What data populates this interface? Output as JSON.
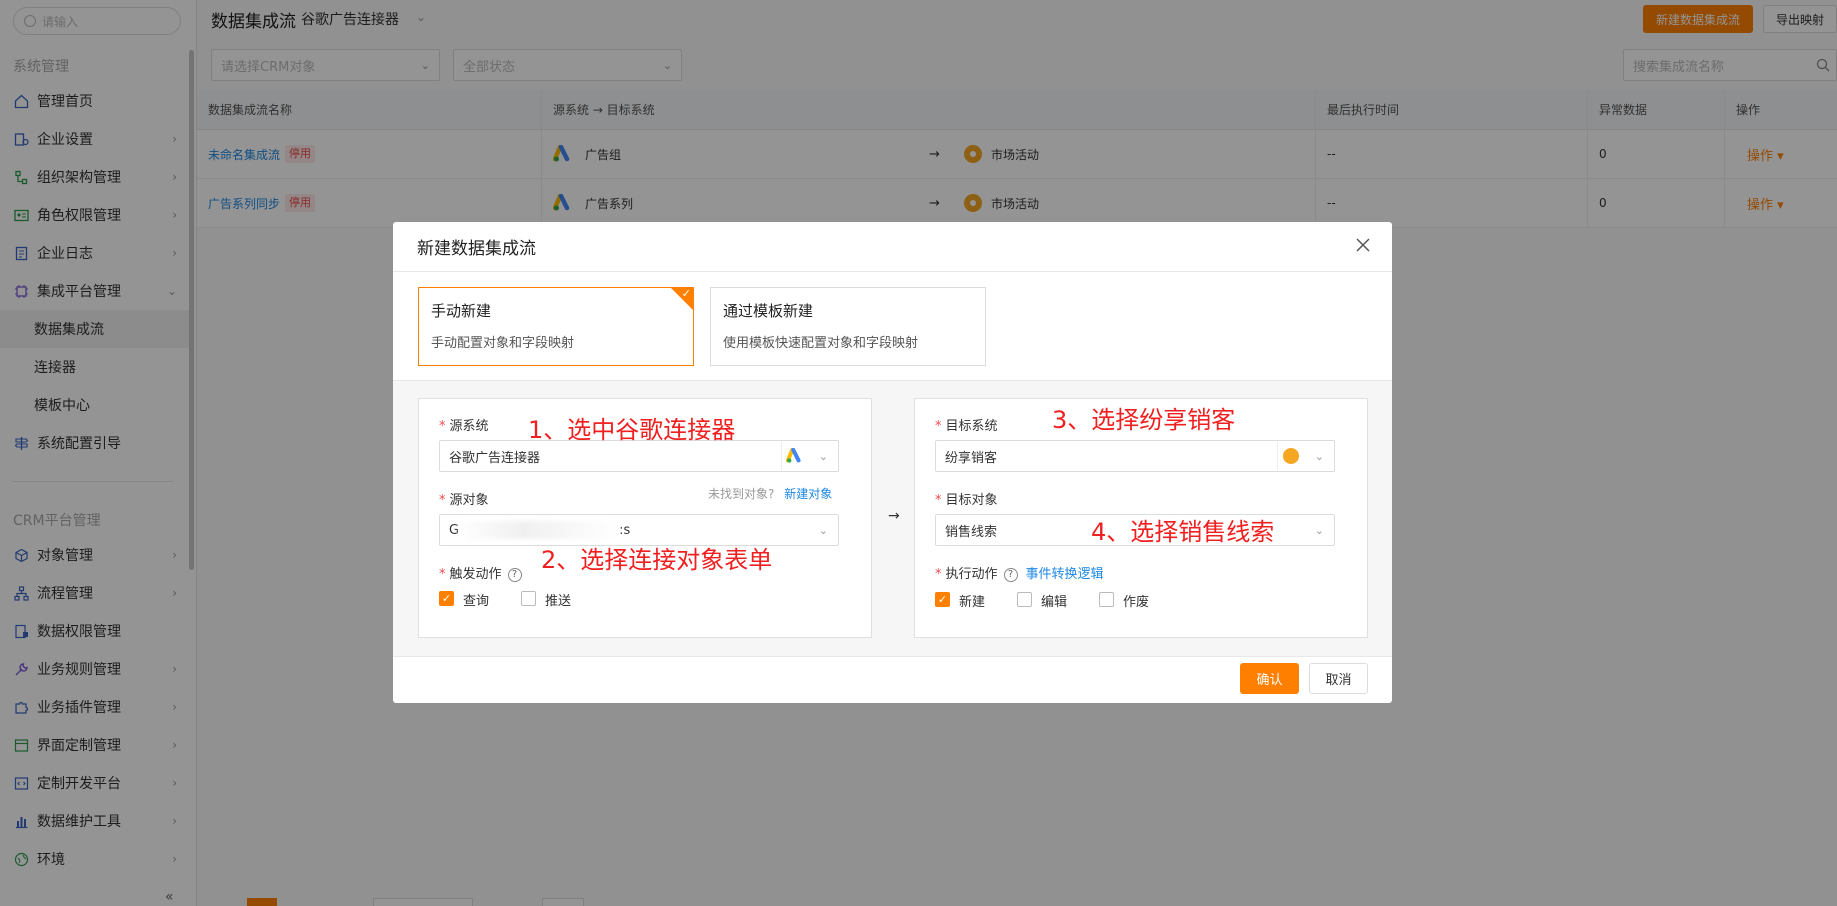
{
  "sidebar": {
    "search_placeholder": "请输入",
    "section_system": "系统管理",
    "section_crm": "CRM平台管理",
    "items": [
      {
        "label": "管理首页"
      },
      {
        "label": "企业设置"
      },
      {
        "label": "组织架构管理"
      },
      {
        "label": "角色权限管理"
      },
      {
        "label": "企业日志"
      },
      {
        "label": "集成平台管理"
      },
      {
        "label": "数据集成流"
      },
      {
        "label": "连接器"
      },
      {
        "label": "模板中心"
      },
      {
        "label": "系统配置引导"
      },
      {
        "label": "对象管理"
      },
      {
        "label": "流程管理"
      },
      {
        "label": "数据权限管理"
      },
      {
        "label": "业务规则管理"
      },
      {
        "label": "业务插件管理"
      },
      {
        "label": "界面定制管理"
      },
      {
        "label": "定制开发平台"
      },
      {
        "label": "数据维护工具"
      },
      {
        "label": "环境"
      }
    ],
    "collapse_glyph": "«"
  },
  "header": {
    "title": "数据集成流",
    "connector": "谷歌广告连接器",
    "new_button": "新建数据集成流",
    "export_button": "导出映射"
  },
  "filters": {
    "crm_object_placeholder": "请选择CRM对象",
    "status_placeholder": "全部状态",
    "search_placeholder": "搜索集成流名称"
  },
  "table": {
    "columns": [
      "数据集成流名称",
      "源系统 → 目标系统",
      "最后执行时间",
      "异常数据",
      "操作"
    ],
    "rows": [
      {
        "name": "未命名集成流",
        "status": "停用",
        "source": "广告组",
        "target": "市场活动",
        "last_run": "--",
        "errors": "0",
        "action": "操作"
      },
      {
        "name": "广告系列同步",
        "status": "停用",
        "source": "广告系列",
        "target": "市场活动",
        "last_run": "--",
        "errors": "0",
        "action": "操作"
      }
    ]
  },
  "modal": {
    "title": "新建数据集成流",
    "cards": [
      {
        "title": "手动新建",
        "desc": "手动配置对象和字段映射"
      },
      {
        "title": "通过模板新建",
        "desc": "使用模板快速配置对象和字段映射"
      }
    ],
    "source": {
      "system_label": "源系统",
      "system_value": "谷歌广告连接器",
      "object_label": "源对象",
      "object_hint": "未找到对象?",
      "object_link": "新建对象",
      "object_value_prefix": "G",
      "object_value_suffix": ":s",
      "trigger_label": "触发动作",
      "trigger_options": [
        {
          "label": "查询",
          "checked": true
        },
        {
          "label": "推送",
          "checked": false
        }
      ]
    },
    "target": {
      "system_label": "目标系统",
      "system_value": "纷享销客",
      "object_label": "目标对象",
      "object_value": "销售线索",
      "action_label": "执行动作",
      "action_link": "事件转换逻辑",
      "action_options": [
        {
          "label": "新建",
          "checked": true
        },
        {
          "label": "编辑",
          "checked": false
        },
        {
          "label": "作废",
          "checked": false
        }
      ]
    },
    "annotations": [
      "1、选中谷歌连接器",
      "2、选择连接对象表单",
      "3、选择纷享销客",
      "4、选择销售线索"
    ],
    "confirm": "确认",
    "cancel": "取消"
  },
  "colors": {
    "accent": "#ff8000",
    "link": "#1e88e5",
    "danger": "#f04a4a",
    "annotation": "#f02020"
  }
}
